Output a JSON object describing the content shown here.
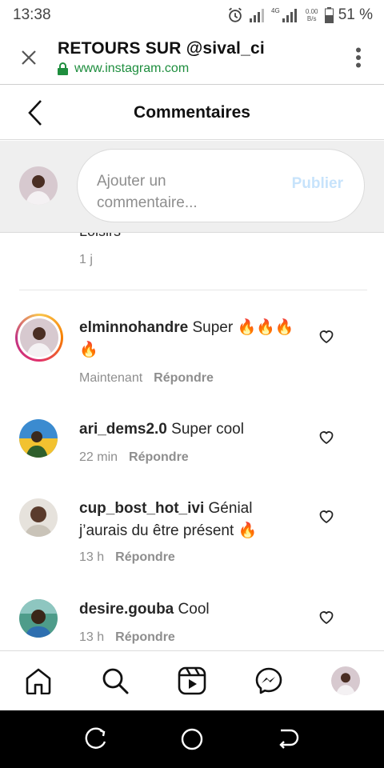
{
  "status_bar": {
    "time": "13:38",
    "network": "4G",
    "net_speed": "0.00\nB/s",
    "battery": "51 %",
    "icons": [
      "alarm-icon",
      "signal-icon",
      "signal-4g-icon",
      "battery-icon"
    ]
  },
  "browser": {
    "title": "RETOURS SUR @sival_ci",
    "url": "www.instagram.com",
    "icons": [
      "close-icon",
      "lock-icon",
      "more-vert-icon"
    ],
    "url_color": "#1e8e3e"
  },
  "header": {
    "title": "Commentaires",
    "back_icon": "chevron-left-icon"
  },
  "compose": {
    "placeholder": "Ajouter un commentaire...",
    "publish_label": "Publier",
    "publish_color": "#c7e3fb"
  },
  "previous_comment": {
    "text": "Loisirs",
    "time": "1 j"
  },
  "comments": [
    {
      "username": "elminnohandre",
      "text": "Super 🔥🔥🔥🔥",
      "time": "Maintenant",
      "reply_label": "Répondre",
      "has_story_ring": true
    },
    {
      "username": "ari_dems2.0",
      "text": "Super cool",
      "time": "22 min",
      "reply_label": "Répondre",
      "has_story_ring": false
    },
    {
      "username": "cup_bost_hot_ivi",
      "text": "Génial j’aurais du être présent 🔥",
      "time": "13 h",
      "reply_label": "Répondre",
      "has_story_ring": false
    },
    {
      "username": "desire.gouba",
      "text": "Cool",
      "time": "13 h",
      "reply_label": "Répondre",
      "has_story_ring": false
    }
  ],
  "bottom_nav": {
    "items": [
      "home-icon",
      "search-icon",
      "reels-icon",
      "messenger-icon",
      "profile-avatar"
    ]
  },
  "android_nav": {
    "items": [
      "recents-icon",
      "home-circle-icon",
      "back-icon"
    ]
  },
  "colors": {
    "accent_blue": "#0095f6",
    "compose_bg": "#efefef",
    "secondary_text": "#8e8e8e"
  }
}
